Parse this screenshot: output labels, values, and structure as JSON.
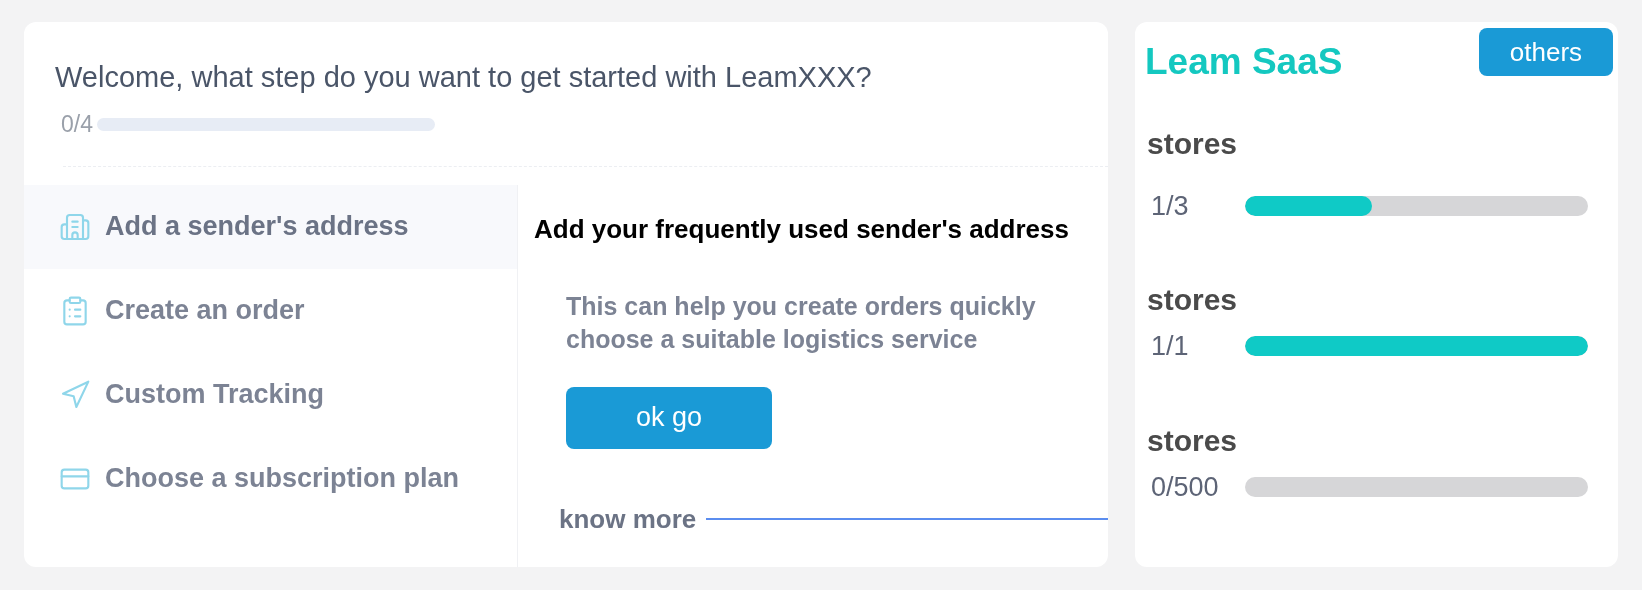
{
  "onboarding": {
    "title": "Welcome, what step do you want to get started with LeamXXX?",
    "progress": {
      "reading": "0/4",
      "level": 0
    },
    "steps": [
      {
        "kind": "address",
        "label": "Add a sender's address",
        "selected": true
      },
      {
        "kind": "order",
        "label": "Create an order",
        "selected": false
      },
      {
        "kind": "tracking",
        "label": "Custom Tracking",
        "selected": false
      },
      {
        "kind": "plan",
        "label": "Choose a subscription plan",
        "selected": false
      }
    ],
    "detail": {
      "heading": "Add your frequently used sender's address",
      "description": "This can help you create orders quickly choose a suitable logistics service",
      "button": "ok go",
      "link": "know more"
    }
  },
  "plan": {
    "title": "Leam SaaS",
    "button": "others",
    "quotas": [
      {
        "label": "stores",
        "reading": "1/3",
        "level": 0.37
      },
      {
        "label": "stores",
        "reading": "1/1",
        "level": 1
      },
      {
        "label": "stores",
        "reading": "0/500",
        "level": 0
      }
    ]
  }
}
